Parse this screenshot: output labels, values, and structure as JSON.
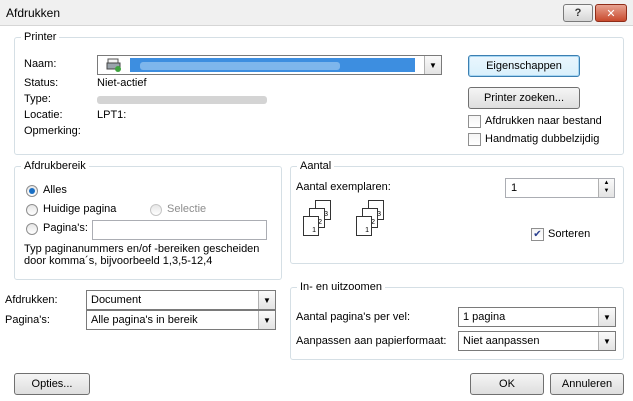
{
  "window": {
    "title": "Afdrukken",
    "help_label": "?",
    "close_label": "✕"
  },
  "printer": {
    "group_label": "Printer",
    "name_label": "Naam:",
    "status_label": "Status:",
    "status_value": "Niet-actief",
    "type_label": "Type:",
    "location_label": "Locatie:",
    "location_value": "LPT1:",
    "comment_label": "Opmerking:",
    "properties_button": "Eigenschappen",
    "find_printer_button": "Printer zoeken...",
    "print_to_file": {
      "label": "Afdrukken naar bestand",
      "checked": false
    },
    "manual_duplex": {
      "label": "Handmatig dubbelzijdig",
      "checked": false
    }
  },
  "range": {
    "group_label": "Afdrukbereik",
    "all": "Alles",
    "current_page": "Huidige pagina",
    "selection": "Selectie",
    "pages": "Pagina's:",
    "pages_value": "",
    "help_line1": "Typ paginanummers en/of -bereiken gescheiden",
    "help_line2": "door komma´s, bijvoorbeeld 1,3,5-12,4"
  },
  "copies": {
    "group_label": "Aantal",
    "count_label": "Aantal exemplaren:",
    "count_value": "1",
    "collate": {
      "label": "Sorteren",
      "checked": true
    },
    "page_numbers": [
      "1",
      "2",
      "3",
      "1",
      "2",
      "3"
    ]
  },
  "print_what": {
    "label": "Afdrukken:",
    "value": "Document"
  },
  "print_pages": {
    "label": "Pagina's:",
    "value": "Alle pagina's in bereik"
  },
  "zoom": {
    "group_label": "In- en uitzoomen",
    "pages_per_sheet_label": "Aantal pagina's per vel:",
    "pages_per_sheet_value": "1 pagina",
    "scale_label": "Aanpassen aan papierformaat:",
    "scale_value": "Niet aanpassen"
  },
  "footer": {
    "options": "Opties...",
    "ok": "OK",
    "cancel": "Annuleren"
  }
}
